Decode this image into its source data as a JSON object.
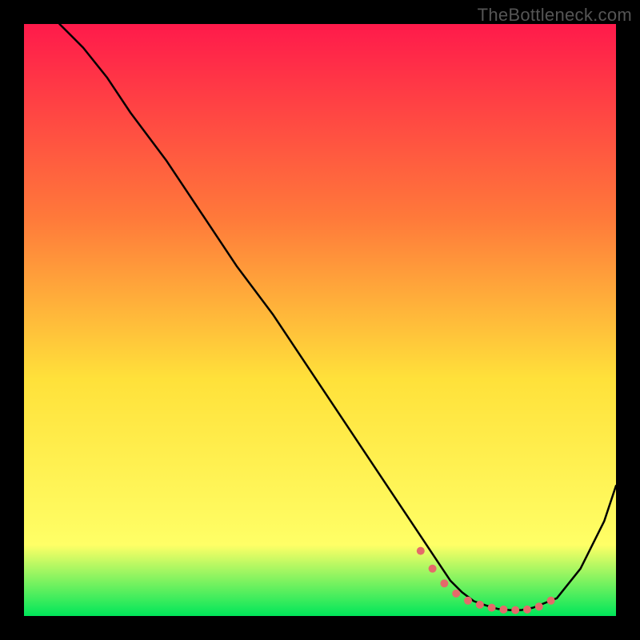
{
  "watermark": "TheBottleneck.com",
  "colors": {
    "gradient_top": "#ff1a4b",
    "gradient_mid1": "#ff7a3a",
    "gradient_mid2": "#ffe13a",
    "gradient_low": "#ffff66",
    "gradient_bottom": "#00e65a",
    "curve": "#000000",
    "dot_fill": "#e56a6a",
    "frame": "#000000"
  },
  "chart_data": {
    "type": "line",
    "title": "",
    "xlabel": "",
    "ylabel": "",
    "xlim": [
      0,
      100
    ],
    "ylim": [
      0,
      100
    ],
    "series": [
      {
        "name": "bottleneck-curve",
        "x": [
          6,
          8,
          10,
          14,
          18,
          24,
          30,
          36,
          42,
          48,
          54,
          60,
          64,
          68,
          70,
          72,
          74,
          76,
          78,
          80,
          82,
          84,
          86,
          90,
          94,
          98,
          100
        ],
        "y": [
          100,
          98,
          96,
          91,
          85,
          77,
          68,
          59,
          51,
          42,
          33,
          24,
          18,
          12,
          9,
          6,
          4,
          2.5,
          1.8,
          1.2,
          1,
          1,
          1.4,
          3,
          8,
          16,
          22
        ]
      }
    ],
    "dots": {
      "name": "optimal-range-markers",
      "x": [
        67,
        69,
        71,
        73,
        75,
        77,
        79,
        81,
        83,
        85,
        87,
        89
      ],
      "y": [
        11,
        8,
        5.5,
        3.8,
        2.6,
        1.9,
        1.4,
        1.1,
        1.0,
        1.1,
        1.6,
        2.6
      ]
    }
  }
}
